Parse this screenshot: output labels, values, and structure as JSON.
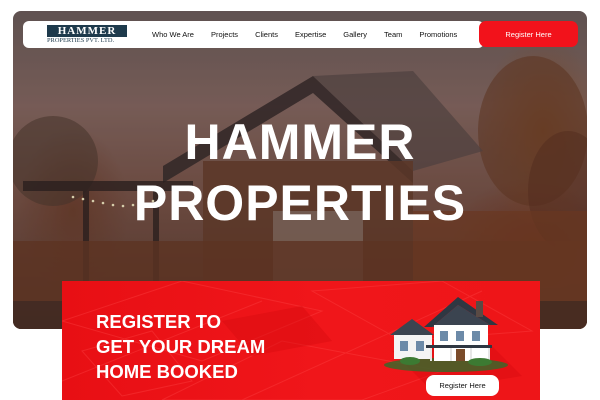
{
  "brand": {
    "logo_main": "HAMMER",
    "logo_sub": "PROPERTIES PVT. LTD."
  },
  "nav": {
    "items": [
      {
        "label": "Who We Are"
      },
      {
        "label": "Projects"
      },
      {
        "label": "Clients"
      },
      {
        "label": "Expertise"
      },
      {
        "label": "Gallery"
      },
      {
        "label": "Team"
      },
      {
        "label": "Promotions"
      }
    ],
    "cta_label": "Register Here"
  },
  "hero": {
    "title_line1": "HAMMER",
    "title_line2": "PROPERTIES"
  },
  "banner": {
    "line1": "REGISTER TO",
    "line2": "GET YOUR DREAM",
    "line3": "HOME BOOKED",
    "cta_label": "Register Here",
    "illustration": "house-icon"
  },
  "colors": {
    "accent_red": "#f2121b",
    "logo_navy": "#1e3a4c",
    "white": "#ffffff"
  }
}
